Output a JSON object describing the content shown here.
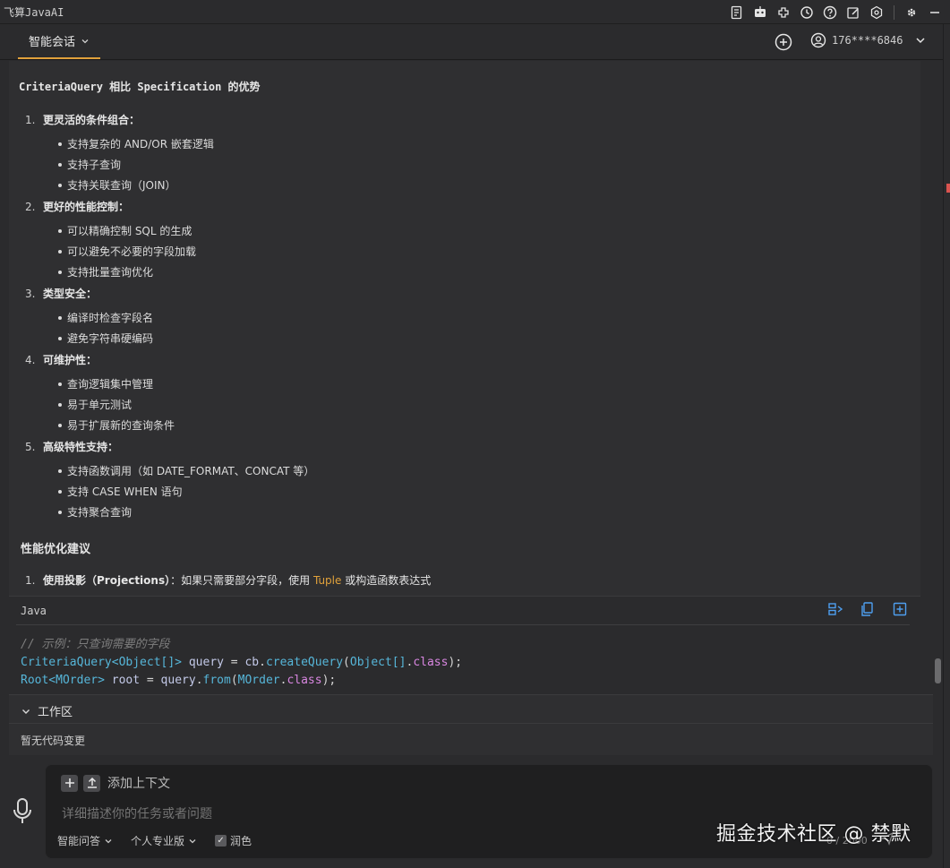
{
  "app": {
    "title": "飞算JavaAI"
  },
  "session": {
    "tab_label": "智能会话",
    "user": "176****6846"
  },
  "message": {
    "heading": "CriteriaQuery 相比 Specification 的优势",
    "sections": [
      {
        "num": "1.",
        "label": "更灵活的条件组合：",
        "items": [
          "支持复杂的 AND/OR 嵌套逻辑",
          "支持子查询",
          "支持关联查询（JOIN）"
        ]
      },
      {
        "num": "2.",
        "label": "更好的性能控制：",
        "items": [
          "可以精确控制 SQL 的生成",
          "可以避免不必要的字段加载",
          "支持批量查询优化"
        ]
      },
      {
        "num": "3.",
        "label": "类型安全：",
        "items": [
          "编译时检查字段名",
          "避免字符串硬编码"
        ]
      },
      {
        "num": "4.",
        "label": "可维护性：",
        "items": [
          "查询逻辑集中管理",
          "易于单元测试",
          "易于扩展新的查询条件"
        ]
      },
      {
        "num": "5.",
        "label": "高级特性支持：",
        "items": [
          "支持函数调用（如 DATE_FORMAT、CONCAT 等）",
          "支持 CASE WHEN 语句",
          "支持聚合查询"
        ]
      }
    ],
    "perf_heading": "性能优化建议",
    "perf_item": {
      "num": "1.",
      "label": "使用投影（Projections）",
      "text_before": "：如果只需要部分字段，使用 ",
      "code": "Tuple",
      "text_after": " 或构造函数表达式"
    }
  },
  "codeblock": {
    "language": "Java",
    "comment": "// 示例：只查询需要的字段",
    "line2": {
      "type": "CriteriaQuery<Object[]>",
      "var": " query",
      "eq": " = ",
      "obj": "cb",
      "dot": ".",
      "method": "createQuery",
      "arg_open": "(",
      "arg_type": "Object[]",
      "arg_dot": ".",
      "arg_kw": "class",
      "arg_close": ");"
    },
    "line3": {
      "type": "Root<MOrder>",
      "var": " root",
      "eq": " = ",
      "obj": "query",
      "dot": ".",
      "method": "from",
      "arg_open": "(",
      "arg_type": "MOrder",
      "arg_dot": ".",
      "arg_kw": "class",
      "arg_close": ");"
    }
  },
  "workspace": {
    "title": "工作区",
    "empty": "暂无代码变更"
  },
  "input": {
    "add_context": "添加上下文",
    "placeholder": "详细描述你的任务或者问题",
    "mode": "智能问答",
    "plan": "个人专业版",
    "polish": "润色",
    "counter": "0 / 2000"
  },
  "watermark": "掘金技术社区 @ 禁默",
  "colors": {
    "accent": "#e0a13b",
    "link_blue": "#4e9ff0",
    "background": "#2b2b2d"
  }
}
